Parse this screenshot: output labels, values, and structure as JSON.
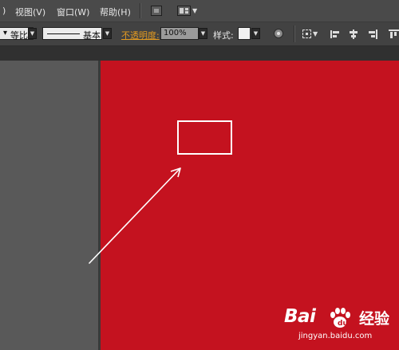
{
  "menubar": {
    "items": [
      {
        "label": "视图(V)"
      },
      {
        "label": "窗口(W)"
      },
      {
        "label": "帮助(H)"
      }
    ],
    "icons": [
      "bridge-icon",
      "arrange-documents-icon"
    ]
  },
  "control_bar": {
    "proportion_value": "等比",
    "stroke_profile_label": "基本",
    "opacity_label": "不透明度:",
    "opacity_value": "100%",
    "style_label": "样式:"
  },
  "colors": {
    "artboard": "#c4121f",
    "opacity_label": "#e39a20",
    "drawn_shape_stroke": "#ffffff"
  },
  "watermark": {
    "brand": "Bai",
    "brand_suffix": "经验",
    "site": "jingyan.baidu.com"
  }
}
